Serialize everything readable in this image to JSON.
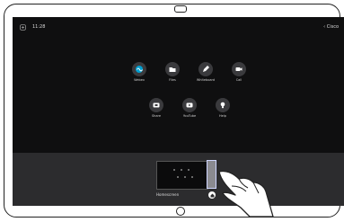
{
  "status": {
    "time": "11:28",
    "right_label": "Cisco"
  },
  "apps": [
    {
      "key": "webex",
      "label": "Webex",
      "icon": "webex-icon",
      "color": "#00a0d1"
    },
    {
      "key": "files",
      "label": "Files",
      "icon": "folder-icon"
    },
    {
      "key": "whiteboard",
      "label": "Whiteboard",
      "icon": "pencil-icon"
    },
    {
      "key": "call",
      "label": "Call",
      "icon": "camera-icon"
    },
    {
      "key": "share",
      "label": "Share",
      "icon": "share-icon"
    },
    {
      "key": "youtube",
      "label": "YouTube",
      "icon": "play-icon"
    },
    {
      "key": "help",
      "label": "Help",
      "icon": "lightbulb-icon"
    }
  ],
  "tray": {
    "label": "Homescreen"
  },
  "colors": {
    "screen": "#0f0f10",
    "tray": "#2c2c2e",
    "accent": "#00a0d1"
  }
}
